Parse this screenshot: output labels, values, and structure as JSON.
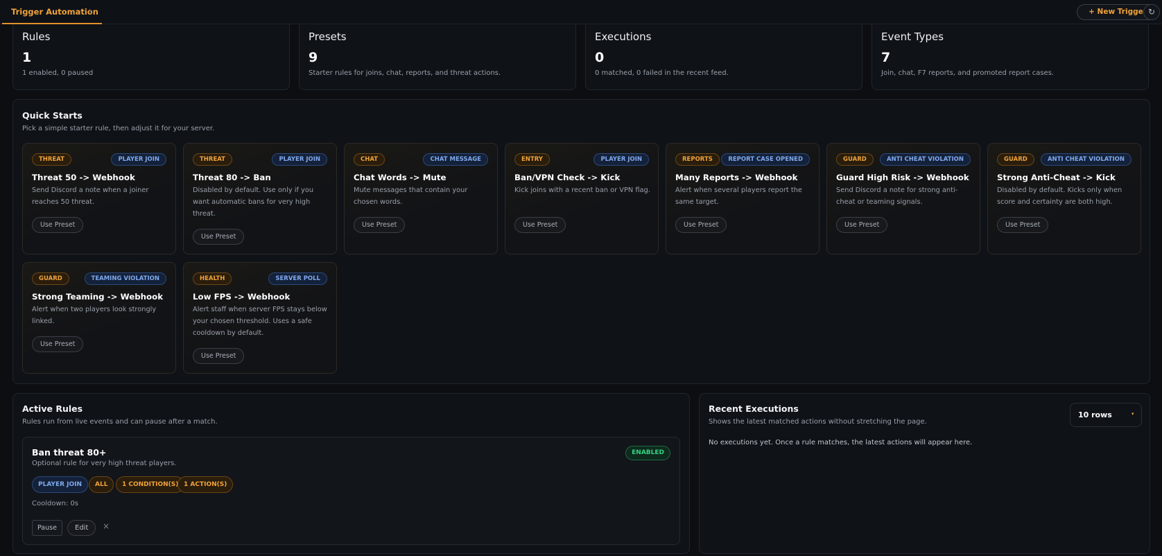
{
  "tabs": {
    "active_label": "Trigger Automation",
    "count": "1"
  },
  "toolbar": {
    "new_trigger_label": "+ New Trigger",
    "refresh_icon": "↻"
  },
  "stats": [
    {
      "title": "Rules",
      "value": "1",
      "desc": "1 enabled, 0 paused"
    },
    {
      "title": "Presets",
      "value": "9",
      "desc": "Starter rules for joins, chat, reports, and threat actions."
    },
    {
      "title": "Executions",
      "value": "0",
      "desc": "0 matched, 0 failed in the recent feed."
    },
    {
      "title": "Event Types",
      "value": "7",
      "desc": "Join, chat, F7 reports, and promoted report cases."
    }
  ],
  "quick_starts": {
    "title": "Quick Starts",
    "subtitle": "Pick a simple starter rule, then adjust it for your server.",
    "use_label": "Use Preset",
    "presets": [
      {
        "category": "THREAT",
        "event": "PLAYER JOIN",
        "title": "Threat 50 -> Webhook",
        "desc": "Send Discord a note when a joiner reaches 50 threat."
      },
      {
        "category": "THREAT",
        "event": "PLAYER JOIN",
        "title": "Threat 80 -> Ban",
        "desc": "Disabled by default. Use only if you want automatic bans for very high threat."
      },
      {
        "category": "CHAT",
        "event": "CHAT MESSAGE",
        "title": "Chat Words -> Mute",
        "desc": "Mute messages that contain your chosen words."
      },
      {
        "category": "ENTRY",
        "event": "PLAYER JOIN",
        "title": "Ban/VPN Check -> Kick",
        "desc": "Kick joins with a recent ban or VPN flag."
      },
      {
        "category": "REPORTS",
        "event": "REPORT CASE OPENED",
        "title": "Many Reports -> Webhook",
        "desc": "Alert when several players report the same target."
      },
      {
        "category": "GUARD",
        "event": "ANTI CHEAT VIOLATION",
        "title": "Guard High Risk -> Webhook",
        "desc": "Send Discord a note for strong anti-cheat or teaming signals."
      },
      {
        "category": "GUARD",
        "event": "ANTI CHEAT VIOLATION",
        "title": "Strong Anti-Cheat -> Kick",
        "desc": "Disabled by default. Kicks only when score and certainty are both high."
      },
      {
        "category": "GUARD",
        "event": "TEAMING VIOLATION",
        "title": "Strong Teaming -> Webhook",
        "desc": "Alert when two players look strongly linked."
      },
      {
        "category": "HEALTH",
        "event": "SERVER POLL",
        "title": "Low FPS -> Webhook",
        "desc": "Alert staff when server FPS stays below your chosen threshold. Uses a safe cooldown by default."
      }
    ]
  },
  "active_rules": {
    "title": "Active Rules",
    "subtitle": "Rules run from live events and can pause after a match.",
    "rules": [
      {
        "name": "Ban threat 80+",
        "desc": "Optional rule for very high threat players.",
        "status": "ENABLED",
        "tags": [
          "PLAYER JOIN",
          "ALL",
          "1 CONDITION(S)",
          "1 ACTION(S)"
        ],
        "cooldown": "Cooldown: 0s",
        "pause_label": "Pause",
        "edit_label": "Edit",
        "delete_icon": "×"
      }
    ]
  },
  "recent_executions": {
    "title": "Recent Executions",
    "subtitle": "Shows the latest matched actions without stretching the page.",
    "rows_select": "10 rows",
    "caret_icon": "▾",
    "empty_message": "No executions yet. Once a rule matches, the latest actions will appear here."
  },
  "colors": {
    "accent": "#f0a33b",
    "background": "#0c0e12",
    "panel": "#0f1217",
    "event_chip": "#7fa9ec",
    "enabled": "#35d184"
  }
}
